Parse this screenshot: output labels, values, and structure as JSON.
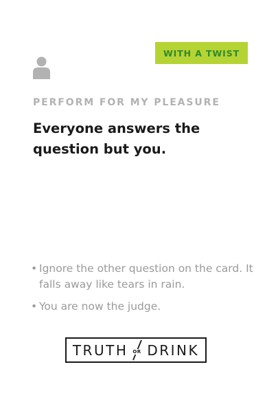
{
  "badge": {
    "label": "WITH A TWIST",
    "background_color": "#b6d334",
    "text_color": "#2e8a2e"
  },
  "icon": {
    "name": "person-icon",
    "color": "#b2b2b2"
  },
  "card": {
    "category": "PERFORM FOR MY PLEASURE",
    "question_line_1": "Everyone answers the",
    "question_line_2": "question but you.",
    "rules": [
      {
        "bullet": "•",
        "text": "Ignore the other question on the card. It falls away like tears in rain."
      },
      {
        "bullet": "•",
        "text": "You are now the judge."
      }
    ]
  },
  "logo": {
    "left_word": "TRUTH",
    "middle": "OR",
    "right_word": "DRINK"
  }
}
